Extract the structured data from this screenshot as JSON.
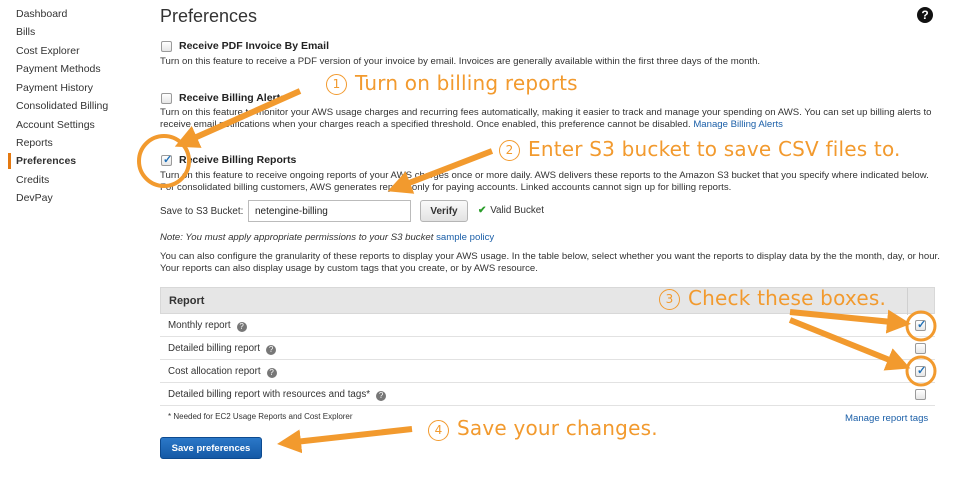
{
  "sidebar": {
    "items": [
      {
        "label": "Dashboard"
      },
      {
        "label": "Bills"
      },
      {
        "label": "Cost Explorer"
      },
      {
        "label": "Payment Methods"
      },
      {
        "label": "Payment History"
      },
      {
        "label": "Consolidated Billing"
      },
      {
        "label": "Account Settings"
      },
      {
        "label": "Reports"
      },
      {
        "label": "Preferences",
        "active": true
      },
      {
        "label": "Credits"
      },
      {
        "label": "DevPay"
      }
    ],
    "accent_color": "#e47911"
  },
  "page": {
    "title": "Preferences",
    "help_icon": "question-circle-icon"
  },
  "prefs": {
    "pdf_invoice": {
      "title": "Receive PDF Invoice By Email",
      "checked": false,
      "description": "Turn on this feature to receive a PDF version of your invoice by email. Invoices are generally available within the first three days of the month."
    },
    "billing_alerts": {
      "title": "Receive Billing Alerts",
      "checked": false,
      "description": "Turn on this feature to monitor your AWS usage charges and recurring fees automatically, making it easier to track and manage your spending on AWS. You can set up billing alerts to receive email notifications when your charges reach a specified threshold. Once enabled, this preference cannot be disabled.",
      "link": "Manage Billing Alerts"
    },
    "billing_reports": {
      "title": "Receive Billing Reports",
      "checked": true,
      "description": "Turn on this feature to receive ongoing reports of your AWS charges once or more daily. AWS delivers these reports to the Amazon S3 bucket that you specify where indicated below. For consolidated billing customers, AWS generates reports only for paying accounts. Linked accounts cannot sign up for billing reports."
    }
  },
  "s3": {
    "label": "Save to S3 Bucket:",
    "value": "netengine-billing",
    "verify_label": "Verify",
    "valid_label": "Valid Bucket"
  },
  "note": {
    "text": "Note: You must apply appropriate permissions to your S3 bucket",
    "link": "sample policy"
  },
  "granularity_text": "You can also configure the granularity of these reports to display your AWS usage. In the table below, select whether you want the reports to display data by the the month, day, or hour. Your reports can also display usage by custom tags that you create, or by AWS resource.",
  "report_table": {
    "header": "Report",
    "rows": [
      {
        "name": "Monthly report",
        "checked": true
      },
      {
        "name": "Detailed billing report",
        "checked": false
      },
      {
        "name": "Cost allocation report",
        "checked": true
      },
      {
        "name": "Detailed billing report with resources and tags*",
        "checked": false
      }
    ]
  },
  "footnote": "* Needed for EC2 Usage Reports and Cost Explorer",
  "manage_tags": "Manage report tags",
  "save_label": "Save preferences",
  "annotations": {
    "color": "#f29a2e",
    "steps": [
      {
        "num": "1",
        "text": "Turn on billing reports"
      },
      {
        "num": "2",
        "text": "Enter S3 bucket to save CSV files to."
      },
      {
        "num": "3",
        "text": "Check these boxes."
      },
      {
        "num": "4",
        "text": "Save your changes."
      }
    ]
  }
}
